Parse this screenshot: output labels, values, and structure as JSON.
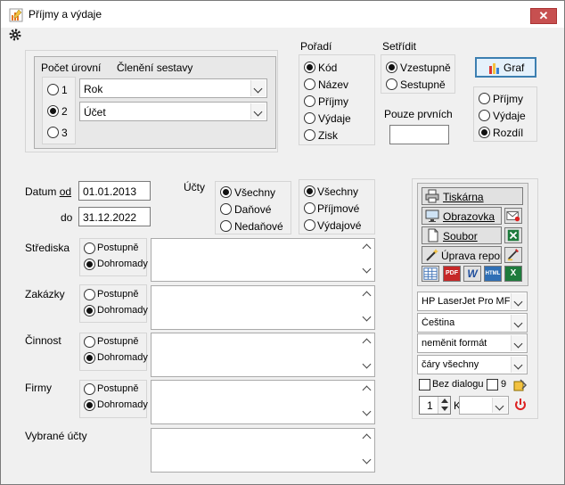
{
  "window": {
    "title": "Příjmy a výdaje",
    "close_label": "✕"
  },
  "levels": {
    "header_count": "Počet úrovní",
    "header_grouping": "Členění sestavy",
    "options": [
      {
        "label": "1",
        "selected": false
      },
      {
        "label": "2",
        "selected": true
      },
      {
        "label": "3",
        "selected": false
      }
    ],
    "grouping_values": [
      "Rok",
      "Účet"
    ]
  },
  "order": {
    "title": "Pořadí",
    "options": [
      {
        "label": "Kód",
        "selected": true
      },
      {
        "label": "Název",
        "selected": false
      },
      {
        "label": "Příjmy",
        "selected": false
      },
      {
        "label": "Výdaje",
        "selected": false
      },
      {
        "label": "Zisk",
        "selected": false
      }
    ]
  },
  "sort": {
    "title": "Setřídit",
    "options": [
      {
        "label": "Vzestupně",
        "selected": true
      },
      {
        "label": "Sestupně",
        "selected": false
      }
    ],
    "first_only_label": "Pouze prvních",
    "first_only_value": ""
  },
  "graph": {
    "button_label": "Graf",
    "options": [
      {
        "label": "Příjmy",
        "selected": false
      },
      {
        "label": "Výdaje",
        "selected": false
      },
      {
        "label": "Rozdíl",
        "selected": true
      }
    ]
  },
  "dates": {
    "from_label_pre": "Datum ",
    "from_label_u": "od",
    "from_value": "01.01.2013",
    "to_label": "do",
    "to_value": "31.12.2022"
  },
  "accounts": {
    "title": "Účty",
    "tax_options": [
      {
        "label": "Všechny",
        "selected": true
      },
      {
        "label": "Daňové",
        "selected": false
      },
      {
        "label": "Nedaňové",
        "selected": false
      }
    ],
    "type_options": [
      {
        "label": "Všechny",
        "selected": true
      },
      {
        "label": "Příjmové",
        "selected": false
      },
      {
        "label": "Výdajové",
        "selected": false
      }
    ]
  },
  "filters": [
    {
      "label": "Střediska",
      "opt1": "Postupně",
      "opt2": "Dohromady"
    },
    {
      "label": "Zakázky",
      "opt1": "Postupně",
      "opt2": "Dohromady"
    },
    {
      "label": "Činnost",
      "opt1": "Postupně",
      "opt2": "Dohromady"
    },
    {
      "label": "Firmy",
      "opt1": "Postupně",
      "opt2": "Dohromady"
    }
  ],
  "selected_accounts_label": "Vybrané účty",
  "output": {
    "print_label": "Tiskárna",
    "screen_label": "Obrazovka",
    "file_label": "Soubor",
    "edit_label": "Úprava repor",
    "printer": "HP LaserJet Pro MFP",
    "language": "Čeština",
    "format": "neměnit formát",
    "lines": "čáry všechny",
    "no_dialog_label": "Bez dialogu",
    "copies_small": "9",
    "copies": "1",
    "k_label": "K",
    "pdf_label": "PDF",
    "word_label": "W",
    "html_label": "HTML",
    "excel_label": "X"
  }
}
